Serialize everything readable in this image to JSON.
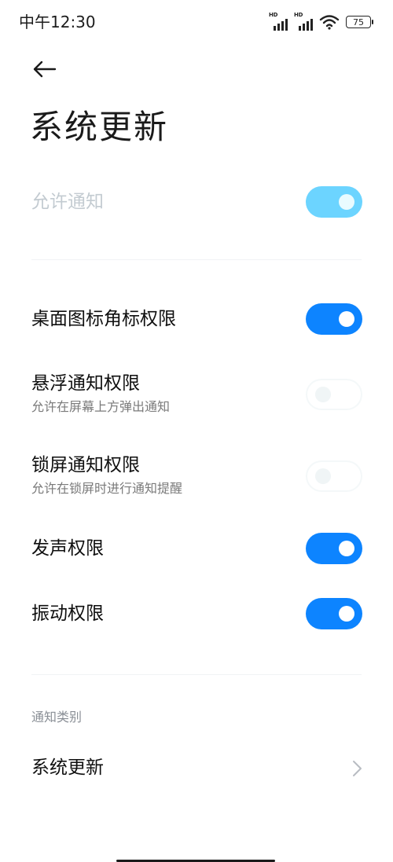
{
  "status_bar": {
    "time": "中午12:30",
    "signal1_label": "HD",
    "signal2_label": "HD",
    "wifi_icon": "wifi-icon",
    "battery": "75"
  },
  "header": {
    "back_icon": "back-arrow-icon",
    "title": "系统更新"
  },
  "settings": {
    "allow_notifications": {
      "label": "允许通知",
      "state": "on",
      "enabled": false
    },
    "badge_permission": {
      "label": "桌面图标角标权限",
      "state": "on"
    },
    "floating_permission": {
      "label": "悬浮通知权限",
      "description": "允许在屏幕上方弹出通知",
      "state": "off"
    },
    "lockscreen_permission": {
      "label": "锁屏通知权限",
      "description": "允许在锁屏时进行通知提醒",
      "state": "off"
    },
    "sound_permission": {
      "label": "发声权限",
      "state": "on"
    },
    "vibration_permission": {
      "label": "振动权限",
      "state": "on"
    }
  },
  "notification_categories": {
    "header": "通知类别",
    "items": [
      {
        "label": "系统更新",
        "icon": "chevron-right-icon"
      }
    ]
  },
  "colors": {
    "accent": "#0d84ff",
    "accent_disabled": "#6cd4ff",
    "subtitle": "#7a7a7a",
    "disabled_text": "#c3cbd1"
  }
}
